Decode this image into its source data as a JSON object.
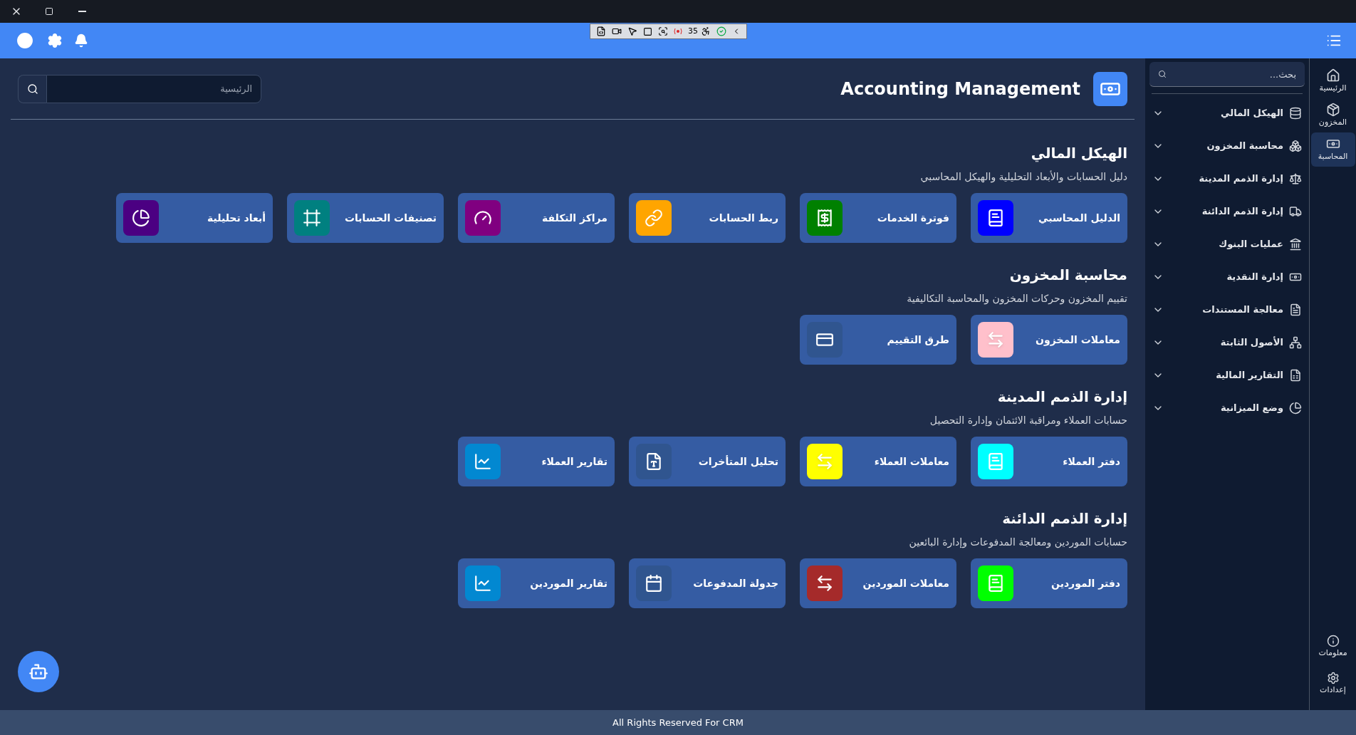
{
  "devtools": {
    "count": "35"
  },
  "header": {
    "title": "Accounting Management",
    "search": {
      "placeholder": "الرئيسية"
    }
  },
  "sections": [
    {
      "title": "الهيكل المالي",
      "description": "دليل الحسابات والأبعاد التحليلية والهيكل المحاسبي",
      "cards": [
        {
          "label": "الدليل المحاسبي",
          "color": "#0000ff"
        },
        {
          "label": "فوترة الخدمات",
          "color": "#008000"
        },
        {
          "label": "ربط الحسابات",
          "color": "#ffa500"
        },
        {
          "label": "مراكز التكلفة",
          "color": "#800080"
        },
        {
          "label": "تصنيفات الحسابات",
          "color": "#008080"
        },
        {
          "label": "أبعاد تحليلية",
          "color": "#4b0082"
        }
      ]
    },
    {
      "title": "محاسبة المخزون",
      "description": "تقييم المخزون وحركات المخزون والمحاسبة التكاليفية",
      "cards": [
        {
          "label": "معاملات المخزون",
          "color": "#ffc0cb"
        },
        {
          "label": "طرق التقييم",
          "color": "#30558f"
        }
      ]
    },
    {
      "title": "إدارة الذمم المدينة",
      "description": "حسابات العملاء ومراقبة الائتمان وإدارة التحصيل",
      "cards": [
        {
          "label": "دفتر العملاء",
          "color": "#00ffff"
        },
        {
          "label": "معاملات العملاء",
          "color": "#ffff00"
        },
        {
          "label": "تحليل المتأخرات",
          "color": "#30558f"
        },
        {
          "label": "تقارير العملاء",
          "color": "#0288d1"
        }
      ]
    },
    {
      "title": "إدارة الذمم الدائنة",
      "description": "حسابات الموردين ومعالجة المدفوعات وإدارة البائعين",
      "cards": [
        {
          "label": "دفتر الموردين",
          "color": "#00ff00"
        },
        {
          "label": "معاملات الموردين",
          "color": "#a52a2a"
        },
        {
          "label": "جدولة المدفوعات",
          "color": "#30558f"
        },
        {
          "label": "تقارير الموردين",
          "color": "#0288d1"
        }
      ]
    }
  ],
  "sidebar": {
    "search": {
      "placeholder": "بحث..."
    },
    "items": [
      {
        "label": "الهيكل المالي",
        "expanded": false
      },
      {
        "label": "محاسبة المخزون",
        "expanded": false
      },
      {
        "label": "إدارة الذمم المدينة",
        "expanded": false
      },
      {
        "label": "إدارة الذمم الدائنة",
        "expanded": false
      },
      {
        "label": "عمليات البنوك",
        "expanded": false
      },
      {
        "label": "إدارة النقدية",
        "expanded": false
      },
      {
        "label": "معالجة المستندات",
        "expanded": false
      },
      {
        "label": "الأصول الثابتة",
        "expanded": false
      },
      {
        "label": "التقارير المالية",
        "expanded": false
      },
      {
        "label": "وضع الميزانية",
        "expanded": false
      }
    ]
  },
  "rail": {
    "items": [
      {
        "label": "الرئيسية",
        "selected": false
      },
      {
        "label": "المخزون",
        "selected": false
      },
      {
        "label": "المحاسبة",
        "selected": true
      }
    ],
    "bottom": [
      {
        "label": "معلومات"
      },
      {
        "label": "إعدادات"
      }
    ]
  },
  "footer": {
    "text": "All Rights Reserved For CRM"
  }
}
